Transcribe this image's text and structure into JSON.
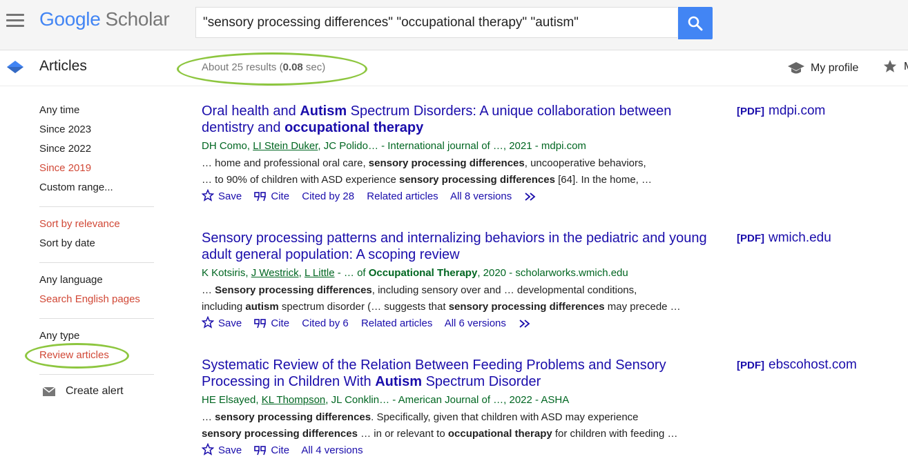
{
  "header": {
    "logo_google": "Google",
    "logo_scholar": "Scholar",
    "search_value": "\"sensory processing differences\" \"occupational therapy\" \"autism\""
  },
  "subbar": {
    "section": "Articles",
    "stats_prefix": "About 25 results (",
    "stats_time": "0.08",
    "stats_suffix": " sec)",
    "my_profile": "My profile",
    "my_library": "M"
  },
  "sidebar": {
    "time": [
      "Any time",
      "Since 2023",
      "Since 2022",
      "Since 2019",
      "Custom range..."
    ],
    "sort": [
      "Sort by relevance",
      "Sort by date"
    ],
    "language": [
      "Any language",
      "Search English pages"
    ],
    "type": [
      "Any type",
      "Review articles"
    ],
    "create_alert": "Create alert"
  },
  "results": [
    {
      "title_parts": [
        "Oral health and ",
        "Autism",
        " Spectrum Disorders: A unique collaboration between dentistry and ",
        "occupational therapy"
      ],
      "authors": [
        "DH Como, ",
        "LI Stein Duker",
        ", JC Polido… - International journal of …, 2021 - mdpi.com"
      ],
      "snippet1": [
        "… home and professional oral care, ",
        "sensory processing differences",
        ", uncooperative behaviors,"
      ],
      "snippet2": [
        "… to 90% of children with ASD experience ",
        "sensory processing differences",
        " [64]. In the home, …"
      ],
      "save": "Save",
      "cite": "Cite",
      "cited_by": "Cited by 28",
      "related": "Related articles",
      "versions": "All 8 versions",
      "pdf_tag": "[PDF]",
      "pdf_source": "mdpi.com"
    },
    {
      "title_parts": [
        "Sensory processing patterns and internalizing behaviors in the pediatric and young adult general population: A scoping review"
      ],
      "authors": [
        "K Kotsiris, ",
        "J Westrick",
        ", ",
        "L Little",
        " - … of ",
        "Occupational Therapy",
        ", 2020 - scholarworks.wmich.edu"
      ],
      "snippet1": [
        "… ",
        "Sensory processing differences",
        ", including sensory over and … developmental conditions,"
      ],
      "snippet2": [
        "including ",
        "autism",
        " spectrum disorder (… suggests that ",
        "sensory processing differences",
        " may precede …"
      ],
      "save": "Save",
      "cite": "Cite",
      "cited_by": "Cited by 6",
      "related": "Related articles",
      "versions": "All 6 versions",
      "pdf_tag": "[PDF]",
      "pdf_source": "wmich.edu"
    },
    {
      "title_parts": [
        "Systematic Review of the Relation Between Feeding Problems and Sensory Processing in Children With ",
        "Autism",
        " Spectrum Disorder"
      ],
      "authors": [
        "HE Elsayed, ",
        "KL Thompson",
        ", JL Conklin… - American Journal of …, 2022 - ASHA"
      ],
      "snippet1": [
        "… ",
        "sensory processing differences",
        ". Specifically, given that children with ASD may experience"
      ],
      "snippet2": [
        "sensory processing differences",
        " … in or relevant to ",
        "occupational therapy",
        " for children with feeding …"
      ],
      "save": "Save",
      "cite": "Cite",
      "versions": "All 4 versions",
      "pdf_tag": "[PDF]",
      "pdf_source": "ebscohost.com"
    }
  ],
  "colors": {
    "link": "#1a0dab",
    "author_green": "#006621",
    "filter_red": "#d14836",
    "highlight_ring": "#8dc63f",
    "search_button": "#4285f4"
  }
}
